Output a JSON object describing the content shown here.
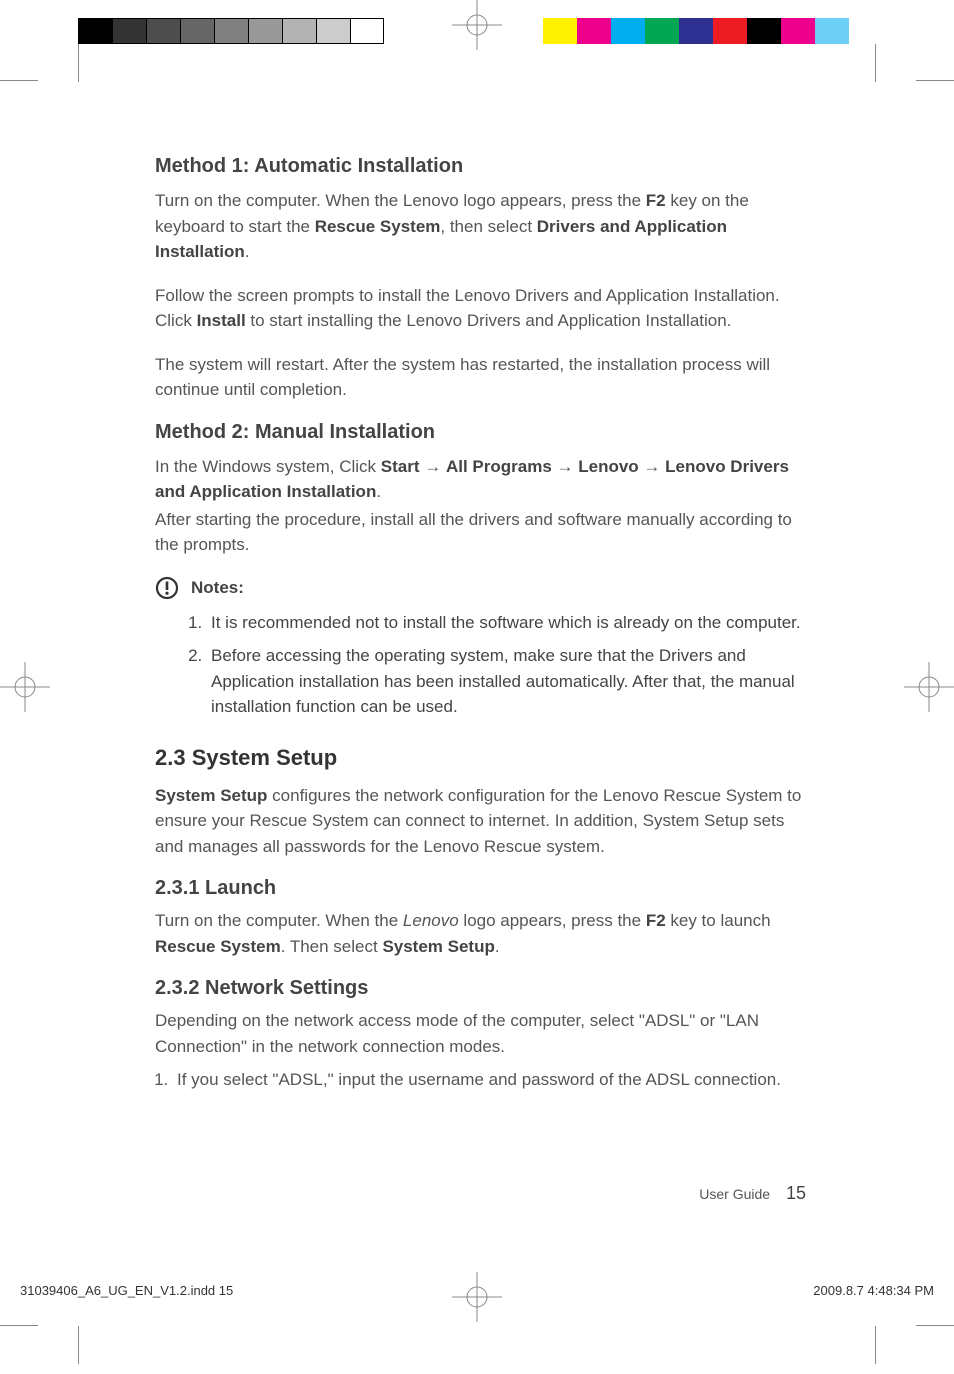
{
  "method1": {
    "heading": "Method 1: Automatic Installation",
    "p1_a": "Turn on the computer. When the Lenovo logo appears, press the ",
    "p1_b": "F2",
    "p1_c": " key on the keyboard to start the ",
    "p1_d": "Rescue System",
    "p1_e": ", then select ",
    "p1_f": "Drivers and Application Installation",
    "p1_g": ".",
    "p2_a": "Follow the screen prompts to install the Lenovo Drivers and Application Installation. Click ",
    "p2_b": "Install",
    "p2_c": " to start installing the  Lenovo Drivers and Application Installation.",
    "p3": "The system will restart. After the system has restarted, the installation process will continue until completion."
  },
  "method2": {
    "heading": "Method 2: Manual Installation",
    "p1_a": "In the Windows system, Click ",
    "p1_b": "Start",
    "p1_arrow": " → ",
    "p1_c": "All Programs",
    "p1_d": "Lenovo",
    "p1_e": "Lenovo Drivers and Application Installation",
    "p1_f": ".",
    "p2": "After starting the procedure, install all the drivers and software manually according to the prompts."
  },
  "notes": {
    "label": "Notes:",
    "item1": "It is recommended not to install the software which is already on the computer.",
    "item2": "Before accessing the operating system, make sure that the Drivers and Application installation has been installed automatically. After that, the manual installation function can be used."
  },
  "s23": {
    "heading": "2.3 System Setup",
    "p1_a": "System Setup",
    "p1_b": " configures the network configuration for the Lenovo Rescue System to ensure your Rescue System can connect to internet. In addition, System Setup sets and manages all passwords for the Lenovo Rescue system."
  },
  "s231": {
    "heading": "2.3.1 Launch",
    "p1_a": "Turn on the computer. When the ",
    "p1_b": "Lenovo",
    "p1_c": " logo appears, press the ",
    "p1_d": "F2",
    "p1_e": " key to launch ",
    "p1_f": "Rescue System",
    "p1_g": ". Then select ",
    "p1_h": "System Setup",
    "p1_i": "."
  },
  "s232": {
    "heading": "2.3.2    Network Settings",
    "p1": "Depending on the network access mode of the computer, select \"ADSL\" or \"LAN Connection\" in the network connection modes.",
    "li1": "If you select \"ADSL,\" input the username and password of the ADSL connection."
  },
  "footer": {
    "label": "User Guide",
    "page": "15"
  },
  "slug": {
    "file": "31039406_A6_UG_EN_V1.2.indd   15",
    "stamp": "2009.8.7   4:48:34 PM"
  },
  "colorbar_left": [
    "#000000",
    "#333333",
    "#4d4d4d",
    "#666666",
    "#808080",
    "#999999",
    "#b3b3b3",
    "#cccccc",
    "#ffffff"
  ],
  "colorbar_right": [
    "#fff200",
    "#ec008c",
    "#00aeef",
    "#00a651",
    "#2e3192",
    "#ed1c24",
    "#000000",
    "#ec008c",
    "#6dcff6"
  ]
}
